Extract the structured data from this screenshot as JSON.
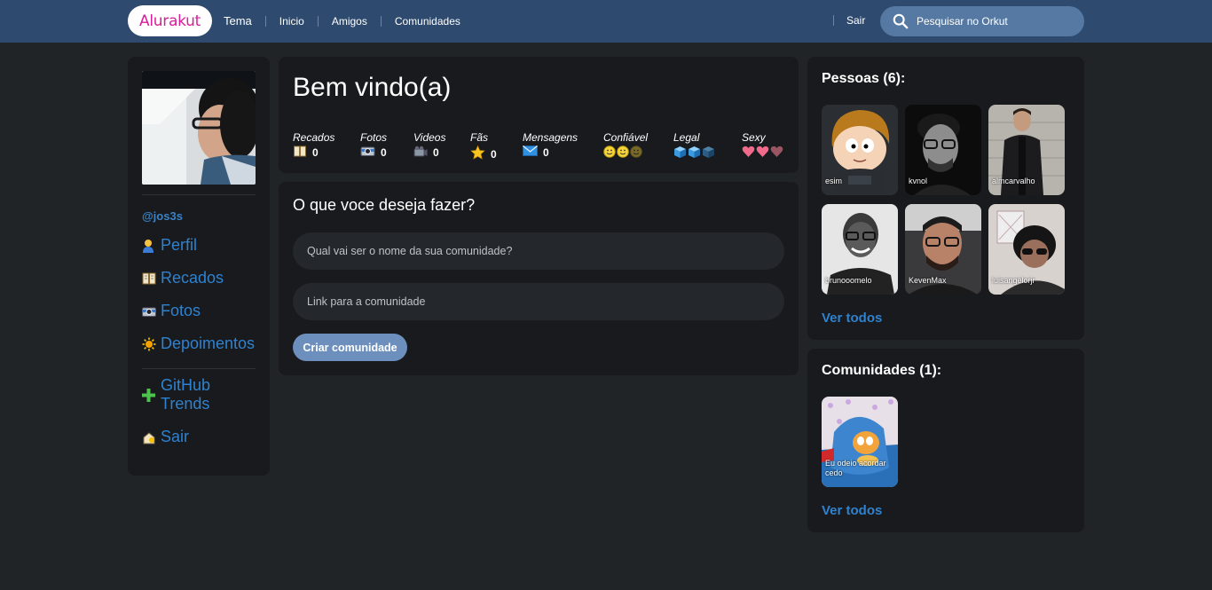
{
  "header": {
    "logo": "Alurakut",
    "nav": [
      "Tema",
      "Inicio",
      "Amigos",
      "Comunidades"
    ],
    "logout": "Sair",
    "search_placeholder": "Pesquisar no Orkut"
  },
  "sidebar": {
    "handle": "@jos3s",
    "items": [
      {
        "label": "Perfil",
        "icon": "user-icon"
      },
      {
        "label": "Recados",
        "icon": "book-icon"
      },
      {
        "label": "Fotos",
        "icon": "camera-icon"
      },
      {
        "label": "Depoimentos",
        "icon": "sun-icon"
      },
      {
        "label": "GitHub Trends",
        "icon": "plus-icon"
      },
      {
        "label": "Sair",
        "icon": "logout-icon"
      }
    ]
  },
  "welcome": {
    "title": "Bem vindo(a)",
    "stats": [
      {
        "label": "Recados",
        "value": "0",
        "icon": "book-icon"
      },
      {
        "label": "Fotos",
        "value": "0",
        "icon": "camera-icon"
      },
      {
        "label": "Videos",
        "value": "0",
        "icon": "video-camera-icon"
      },
      {
        "label": "Fãs",
        "value": "0",
        "icon": "star-icon"
      },
      {
        "label": "Mensagens",
        "value": "0",
        "icon": "envelope-icon"
      }
    ],
    "ratings": [
      {
        "label": "Confiável",
        "icon": "smiley-icon",
        "filled": 2,
        "total": 3
      },
      {
        "label": "Legal",
        "icon": "ice-cube-icon",
        "filled": 2,
        "total": 3
      },
      {
        "label": "Sexy",
        "icon": "heart-icon",
        "filled": 2,
        "total": 3
      }
    ]
  },
  "form": {
    "title": "O que voce deseja fazer?",
    "name_placeholder": "Qual vai ser o nome da sua comunidade?",
    "link_placeholder": "Link para a comunidade",
    "submit": "Criar comunidade"
  },
  "people": {
    "title": "Pessoas (6):",
    "items": [
      "esim",
      "kvnol",
      "almcarvalho",
      "brunooomelo",
      "KevenMax",
      "luisangelorjr"
    ],
    "see_all": "Ver todos"
  },
  "communities": {
    "title": "Comunidades (1):",
    "items": [
      "Eu odeio acordar cedo"
    ],
    "see_all": "Ver todos"
  },
  "colors": {
    "background": "#212427",
    "topbar": "#2e4a6e",
    "box": "#181a1d",
    "link": "#2f82cf",
    "button": "#6d8fbd",
    "logo": "#d81d99"
  }
}
